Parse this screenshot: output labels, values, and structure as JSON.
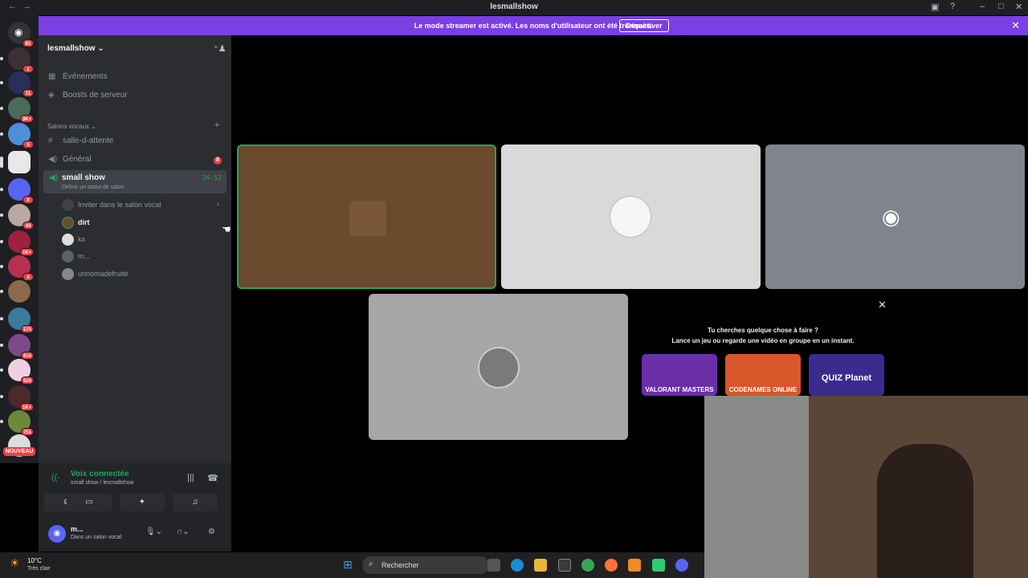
{
  "titlebar": {
    "back_icon": "arrow-left-icon",
    "title": "lesmallshow"
  },
  "banner": {
    "message": "Le mode streamer est activé. Les noms d'utilisateur ont été tronqués.",
    "button_label": "Désactiver"
  },
  "servers": {
    "badges": [
      "81",
      "1",
      "11",
      "3K+",
      "5",
      "",
      "8",
      "43",
      "1K+",
      "5",
      "",
      "175",
      "616",
      "526",
      "1K+",
      "751"
    ],
    "new_label": "NOUVEAU"
  },
  "guild": {
    "name": "lesmallshow",
    "menu": [
      {
        "icon": "calendar-icon",
        "label": "Événements"
      },
      {
        "icon": "boost-icon",
        "label": "Boosts de serveur"
      }
    ],
    "category_label": "Salons vocaux",
    "channels": [
      {
        "icon": "hash-icon",
        "label": "salle-d-attente"
      },
      {
        "icon": "speaker-icon",
        "label": "Général",
        "badge": "8"
      }
    ],
    "active_channel": {
      "name": "small show",
      "status": "Définir un statut de salon",
      "time": "26:52"
    },
    "invite_label": "Inviter dans le salon vocal",
    "members": [
      "dirt",
      "kx",
      "m...",
      "unnomadefruité"
    ]
  },
  "voice_panel": {
    "title": "Voix connectée",
    "subtitle": "small show / lesmallshow"
  },
  "me": {
    "name": "m...",
    "status": "Dans un salon vocal"
  },
  "invite_card": {
    "title": "Tu cherches quelque chose à faire ?",
    "subtitle": "Lance un jeu ou regarde une vidéo en groupe en un instant.",
    "activities": [
      {
        "name": "VALORANT MASTERS",
        "color": "#6a2fa8"
      },
      {
        "name": "CODENAMES ONLINE",
        "color": "#d9572a"
      },
      {
        "name": "QUIZ Planet",
        "color": "#3d2a8f"
      }
    ]
  },
  "taskbar": {
    "temperature": "10°C",
    "weather": "Très clair",
    "search_placeholder": "Rechercher"
  },
  "colors": {
    "accent": "#5865f2",
    "green": "#23a55a",
    "danger": "#f23f43",
    "banner": "#7b3fe4"
  }
}
